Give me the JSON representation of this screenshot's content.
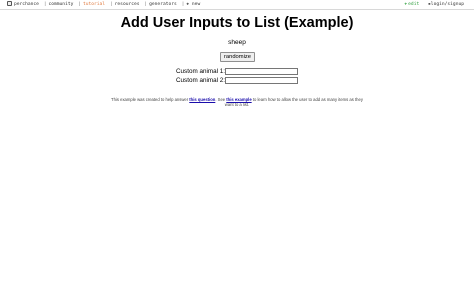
{
  "topbar": {
    "brand": "perchance",
    "nav": [
      {
        "label": "community",
        "active": false
      },
      {
        "label": "tutorial",
        "active": true
      },
      {
        "label": "resources",
        "active": false
      },
      {
        "label": "generators",
        "active": false
      },
      {
        "label": "new",
        "active": false
      }
    ],
    "separator": "|",
    "edit_label": "edit",
    "login_label": "login/signup",
    "colors": {
      "active": "#e07a3f",
      "edit": "#2e9e3d"
    },
    "icons": [
      "perchance-logo-icon",
      "plus-icon",
      "user-icon"
    ]
  },
  "page": {
    "title": "Add User Inputs to List (Example)",
    "output": "sheep",
    "randomize_label": "randomize",
    "field1_label": "Custom animal 1:",
    "field1_value": "",
    "field2_label": "Custom animal 2:",
    "field2_value": ""
  },
  "note": {
    "text_before": "This example was created to help answer",
    "link1": "this question",
    "text_middle": ". See",
    "link2": "this example",
    "text_after": "to learn how to allow the user to add as many items as they want to a list."
  }
}
